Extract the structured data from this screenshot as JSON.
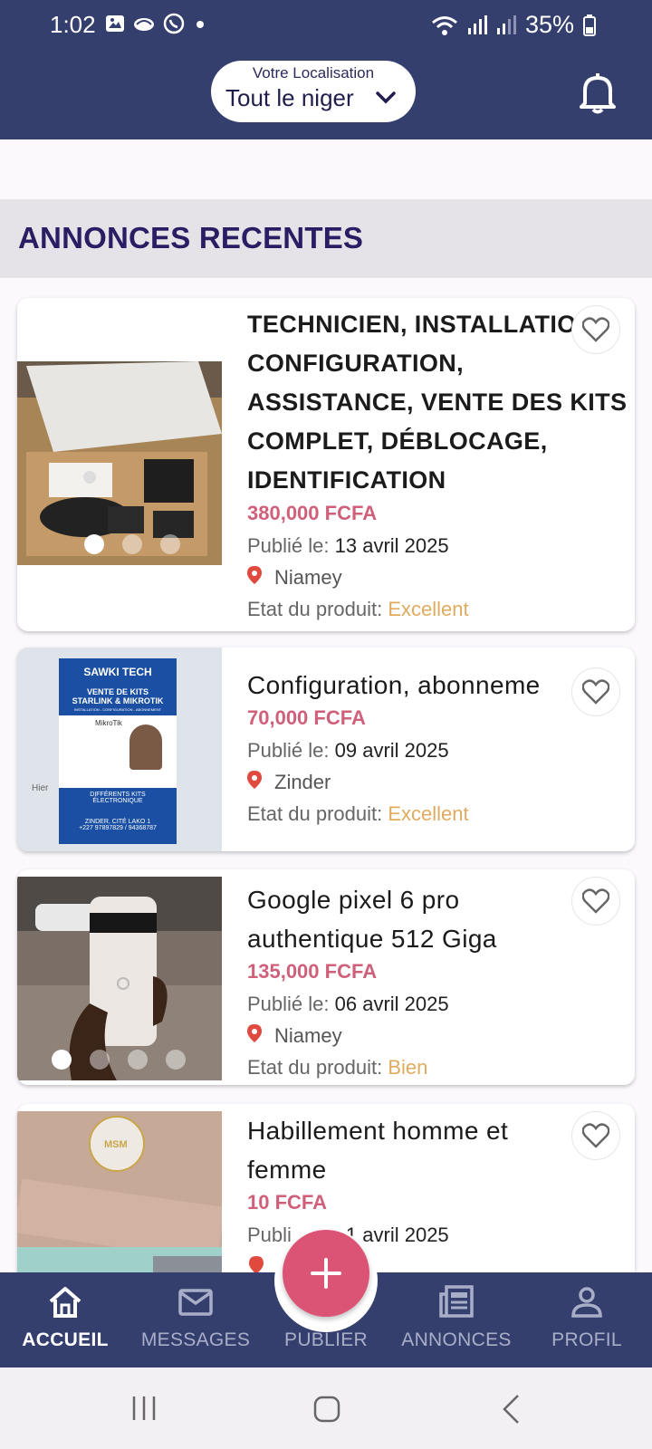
{
  "status_bar": {
    "time": "1:02",
    "battery": "35%"
  },
  "header": {
    "location_caption": "Votre Localisation",
    "location_value": "Tout le niger"
  },
  "section": {
    "title": "ANNONCES RECENTES"
  },
  "listings": [
    {
      "title": "TECHNICIEN, INSTALLATION, CONFIGURATION, ASSISTANCE, VENTE DES KITS COMPLET, DÉBLOCAGE, IDENTIFICATION",
      "price": "380,000 FCFA",
      "published_label": "Publié le: ",
      "published_date": "13 avril 2025",
      "location": "Niamey",
      "state_label": "Etat du produit: ",
      "state_value": "Excellent",
      "image_count": 3,
      "image_index": 1
    },
    {
      "title": "Configuration, abonneme",
      "price": "70,000 FCFA",
      "published_label": "Publié le: ",
      "published_date": "09 avril 2025",
      "location": "Zinder",
      "state_label": "Etat du produit: ",
      "state_value": "Excellent",
      "poster_brand": "SAWKI TECH",
      "poster_line1": "VENTE DE KITS",
      "poster_line2": "STARLINK & MIKROTIK",
      "poster_line3": "INSTALLATION - CONFIGURATION - ABONNEMENT",
      "poster_mikrotik": "MikroTik",
      "poster_line4": "DIFFÉRENTS KITS",
      "poster_line5": "ÉLECTRONIQUE",
      "poster_address": "ZINDER, CITÉ LAKO 1",
      "poster_phone": "+227 97897829 / 94368787",
      "poster_side": "Hier"
    },
    {
      "title": "Google pixel 6 pro authentique 512 Giga",
      "price": "135,000 FCFA",
      "published_label": "Publié le: ",
      "published_date": "06 avril 2025",
      "location": "Niamey",
      "state_label": "Etat du produit: ",
      "state_value": "Bien",
      "image_count": 4,
      "image_index": 1
    },
    {
      "title": "Habillement homme et femme",
      "price": "10 FCFA",
      "published_label": "Publi",
      "published_date": "1 avril 2025",
      "location": "",
      "fabric_brand": "MSM"
    }
  ],
  "bottom_nav": {
    "items": [
      {
        "label": "ACCUEIL",
        "icon": "home-icon",
        "active": true
      },
      {
        "label": "MESSAGES",
        "icon": "mail-icon",
        "active": false
      },
      {
        "label": "PUBLIER",
        "icon": "plus-icon",
        "active": false
      },
      {
        "label": "ANNONCES",
        "icon": "newspaper-icon",
        "active": false
      },
      {
        "label": "PROFIL",
        "icon": "person-icon",
        "active": false
      }
    ]
  },
  "colors": {
    "header_bg": "#353f6e",
    "price": "#d0607a",
    "state": "#e0ab5f",
    "fab": "#dc5475",
    "section_title": "#2a1d63"
  }
}
